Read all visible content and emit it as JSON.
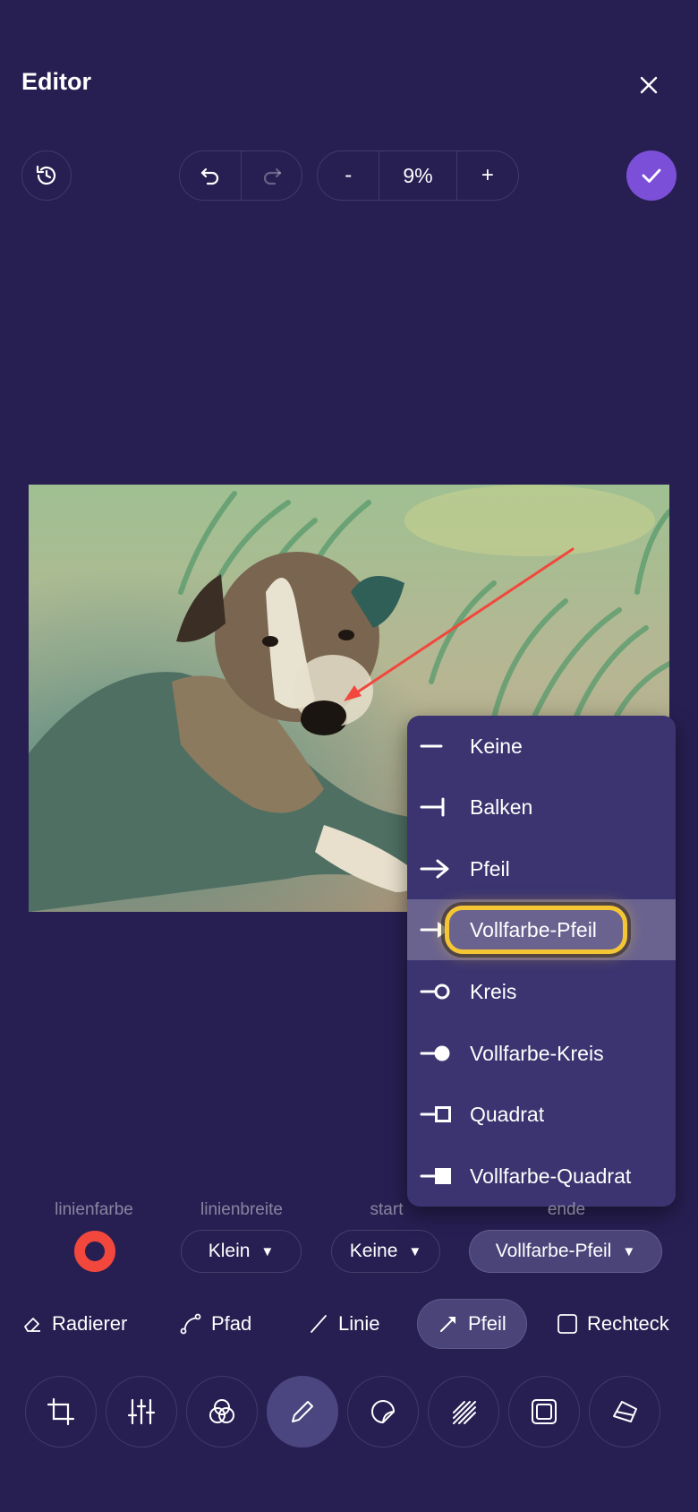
{
  "header": {
    "title": "Editor"
  },
  "toolbar": {
    "zoom": "9%",
    "zoom_out": "-",
    "zoom_in": "+"
  },
  "colors": {
    "accent": "#7b4fd8",
    "background": "#271f52",
    "stroke_color": "#f2473d",
    "highlight": "#f5c634"
  },
  "menu": {
    "items": [
      {
        "label": "Keine",
        "icon": "line-none-icon"
      },
      {
        "label": "Balken",
        "icon": "line-bar-end-icon"
      },
      {
        "label": "Pfeil",
        "icon": "line-arrow-end-icon"
      },
      {
        "label": "Vollfarbe-Pfeil",
        "icon": "line-filled-arrow-end-icon",
        "selected": true
      },
      {
        "label": "Kreis",
        "icon": "line-circle-end-icon"
      },
      {
        "label": "Vollfarbe-Kreis",
        "icon": "line-filled-circle-end-icon"
      },
      {
        "label": "Quadrat",
        "icon": "line-square-end-icon"
      },
      {
        "label": "Vollfarbe-Quadrat",
        "icon": "line-filled-square-end-icon"
      }
    ]
  },
  "properties": {
    "color_label": "linienfarbe",
    "width_label": "linienbreite",
    "width_value": "Klein",
    "start_label": "start",
    "start_value": "Keine",
    "end_label": "ende",
    "end_value": "Vollfarbe-Pfeil",
    "caret": "▼"
  },
  "tools": {
    "eraser": "Radierer",
    "path": "Pfad",
    "line": "Linie",
    "arrow": "Pfeil",
    "rectangle": "Rechteck"
  },
  "nav": [
    "crop-icon",
    "sliders-icon",
    "filters-icon",
    "pencil-icon",
    "sticker-icon",
    "hatch-icon",
    "frame-icon",
    "redact-icon"
  ]
}
